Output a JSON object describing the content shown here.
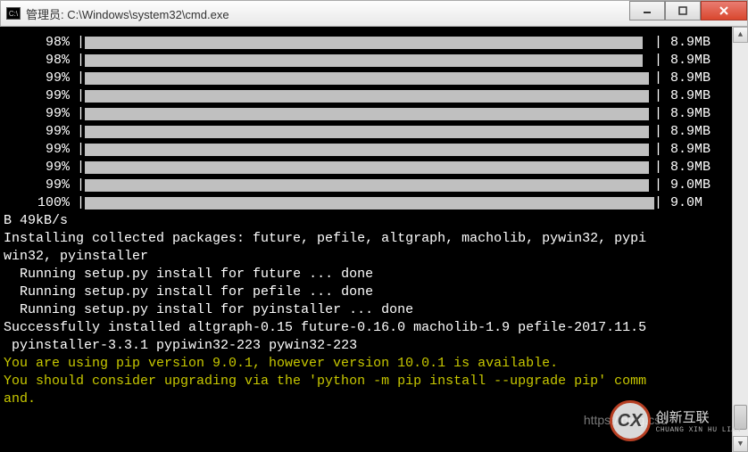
{
  "title": "管理员: C:\\Windows\\system32\\cmd.exe",
  "progress": [
    {
      "pct": "98%",
      "fillPct": 98,
      "size": "8.9MB"
    },
    {
      "pct": "98%",
      "fillPct": 98,
      "size": "8.9MB"
    },
    {
      "pct": "99%",
      "fillPct": 99,
      "size": "8.9MB"
    },
    {
      "pct": "99%",
      "fillPct": 99,
      "size": "8.9MB"
    },
    {
      "pct": "99%",
      "fillPct": 99,
      "size": "8.9MB"
    },
    {
      "pct": "99%",
      "fillPct": 99,
      "size": "8.9MB"
    },
    {
      "pct": "99%",
      "fillPct": 99,
      "size": "8.9MB"
    },
    {
      "pct": "99%",
      "fillPct": 99,
      "size": "8.9MB"
    },
    {
      "pct": "99%",
      "fillPct": 99,
      "size": "9.0MB"
    },
    {
      "pct": "100%",
      "fillPct": 100,
      "size": "9.0M"
    }
  ],
  "lines": {
    "l1": "B 49kB/s",
    "l2": "Installing collected packages: future, pefile, altgraph, macholib, pywin32, pypi",
    "l3": "win32, pyinstaller",
    "l4": "  Running setup.py install for future ... done",
    "l5": "  Running setup.py install for pefile ... done",
    "l6": "  Running setup.py install for pyinstaller ... done",
    "l7": "Successfully installed altgraph-0.15 future-0.16.0 macholib-1.9 pefile-2017.11.5",
    "l8": " pyinstaller-3.3.1 pypiwin32-223 pywin32-223",
    "l9": "You are using pip version 9.0.1, however version 10.0.1 is available.",
    "l10": "You should consider upgrading via the 'python -m pip install --upgrade pip' comm",
    "l11": "and."
  },
  "watermark": {
    "url": "https://blog.csd",
    "brand": "创新互联",
    "sub": "CHUANG XIN HU LIAN"
  },
  "colors": {
    "bar": "#c0c0c0",
    "warn": "#c8c800"
  }
}
